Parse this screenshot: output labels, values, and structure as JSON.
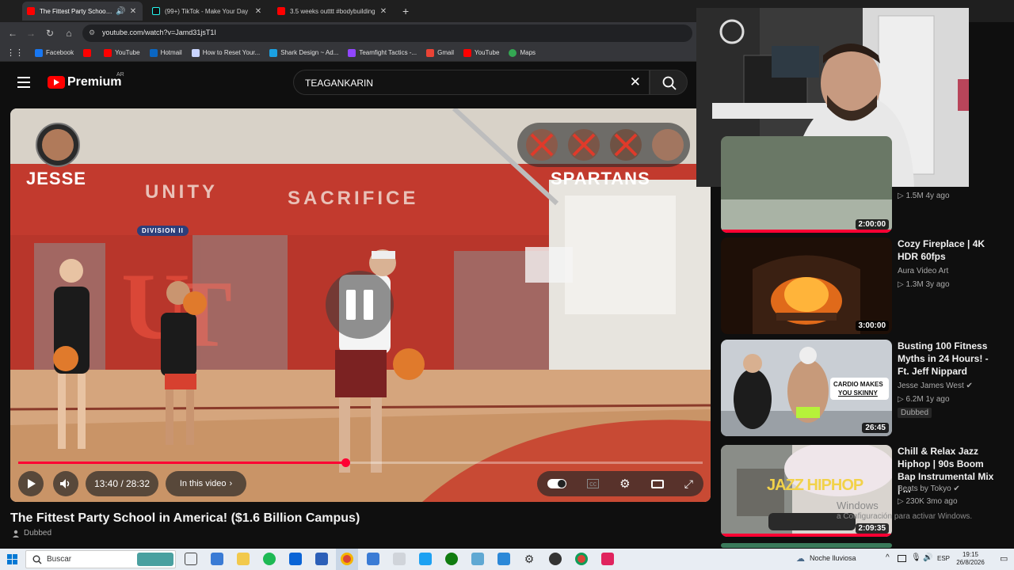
{
  "browser": {
    "tabs": [
      {
        "title": "The Fittest Party School in A",
        "active": true,
        "favicon": "youtube-icon"
      },
      {
        "title": "(99+) TikTok - Make Your Day",
        "active": false,
        "favicon": "tiktok-icon"
      },
      {
        "title": "3.5 weeks outttt #bodybuilding",
        "active": false,
        "favicon": "youtube-icon"
      }
    ],
    "new_tab": "+",
    "url": "youtube.com/watch?v=Jamd31jsT1I",
    "bookmarks": [
      "Facebook",
      "YouTube",
      "Hotmail",
      "How to Reset Your...",
      "Shark Design ~ Ad...",
      "Teamfight Tactics -...",
      "Gmail",
      "YouTube",
      "Maps"
    ]
  },
  "youtube": {
    "brand": "Premium",
    "country": "AR",
    "search_value": "TEAGANKARIN",
    "clear_label": "✕"
  },
  "player": {
    "scene_labels": {
      "left": "JESSE",
      "right": "SPARTANS",
      "banner_left": "UNITY",
      "banner_right": "SACRIFICE",
      "division": "DIVISION II"
    },
    "time": "13:40 / 28:32",
    "chapters_label": "In this video",
    "progress_fraction": 0.478
  },
  "video": {
    "title": "The Fittest Party School in America! ($1.6 Billion Campus)",
    "dubbed": "Dubbed"
  },
  "recommendations": [
    {
      "title": "",
      "channel": "",
      "meta": "1.5M  4y ago",
      "duration": "2:00:00",
      "thumb_color": "#5b6a58"
    },
    {
      "title": "Cozy Fireplace | 4K HDR 60fps",
      "channel": "Aura Video Art",
      "meta": "1.3M  3y ago",
      "duration": "3:00:00",
      "thumb_color": "#2a1308"
    },
    {
      "title": "Busting 100 Fitness Myths in 24 Hours! - Ft. Jeff Nippard",
      "channel": "Jesse James West ✔",
      "meta": "6.2M  1y ago",
      "badge": "Dubbed",
      "duration": "26:45",
      "thumb_color": "#c8cdd2"
    },
    {
      "title": "Chill & Relax Jazz Hiphop | 90s Boom Bap Instrumental Mix | ...",
      "channel": "Beats by Tokyo ✔",
      "meta": "230K  3mo ago",
      "duration": "2:09:35",
      "thumb_color": "#8b8d86"
    }
  ],
  "rec_thumb_text": {
    "cardio_line1": "CARDIO MAKES",
    "cardio_line2": "YOU SKINNY",
    "jazz": "JAZZ HIPHOP"
  },
  "windows_watermark": {
    "line1": "Windows",
    "line2": "a Configuración para activar Windows."
  },
  "taskbar": {
    "search_placeholder": "Buscar",
    "weather": "Noche lluviosa",
    "lang": "ESP",
    "time": "19:15",
    "date": "26/8/2026"
  }
}
